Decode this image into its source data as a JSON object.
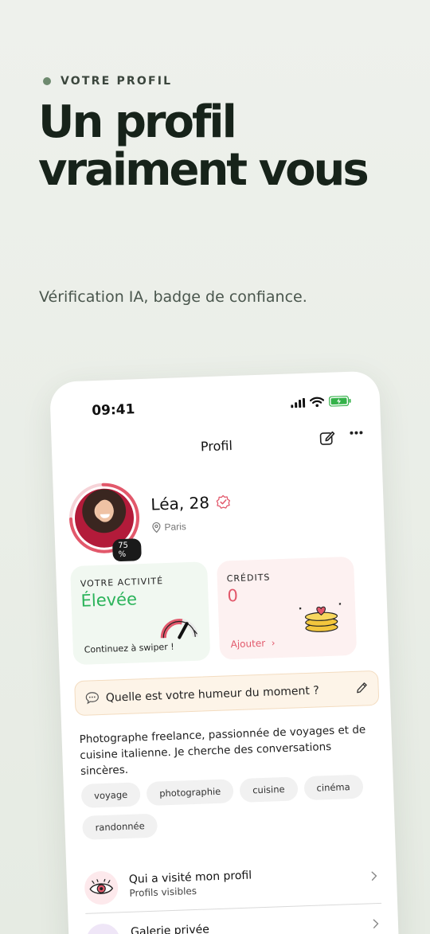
{
  "hero": {
    "eyebrow": "VOTRE PROFIL",
    "title_line1": "Un profil",
    "title_line2": "vraiment vous",
    "subtitle": "Vérification IA, badge de confiance."
  },
  "status_bar": {
    "time": "09:41"
  },
  "navbar": {
    "title": "Profil"
  },
  "profile": {
    "name": "Léa, 28",
    "city": "Paris",
    "completion": "75 %",
    "completion_value": 0.75
  },
  "activity_card": {
    "label": "VOTRE ACTIVITÉ",
    "value": "Élevée",
    "footer": "Continuez à swiper !"
  },
  "credits_card": {
    "label": "CRÉDITS",
    "value": "0",
    "action": "Ajouter"
  },
  "mood": {
    "prompt": "Quelle est votre humeur du moment ?"
  },
  "bio": "Photographe freelance, passionnée de voyages et de cuisine italienne. Je cherche des conversations sincères.",
  "tags": [
    "voyage",
    "photographie",
    "cuisine",
    "cinéma",
    "randonnée"
  ],
  "menu": [
    {
      "title": "Qui a visité mon profil",
      "subtitle": "Profils visibles"
    },
    {
      "title": "Galerie privée"
    }
  ],
  "colors": {
    "accent_green": "#2bb35a",
    "accent_red": "#e2586b",
    "eyebrow_dot": "#6e8a6f"
  }
}
